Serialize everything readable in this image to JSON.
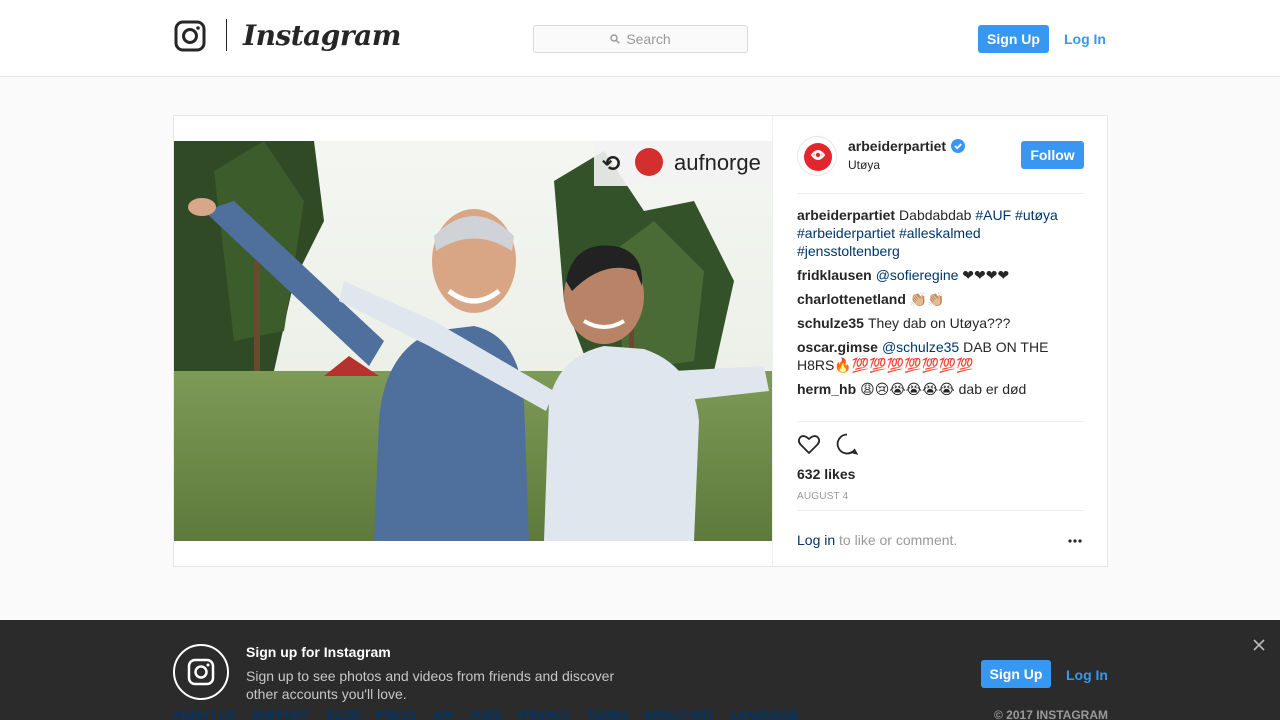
{
  "header": {
    "brand": "Instagram",
    "search_placeholder": "Search",
    "signup_label": "Sign Up",
    "login_label": "Log In"
  },
  "post": {
    "photo_overlay_text": "aufnorge",
    "username": "arbeiderpartiet",
    "location": "Utøya",
    "follow_label": "Follow",
    "caption": {
      "user": "arbeiderpartiet",
      "text": "Dabdabdab",
      "tags": [
        "#AUF",
        "#utøya",
        "#arbeiderpartiet",
        "#alleskalmed",
        "#jensstoltenberg"
      ]
    },
    "comments": [
      {
        "user": "fridklausen",
        "mention": "@sofieregine",
        "text": " ❤❤❤❤"
      },
      {
        "user": "charlottenetland",
        "mention": "",
        "text": "👏🏼👏🏼"
      },
      {
        "user": "schulze35",
        "mention": "",
        "text": "They dab on Utøya???"
      },
      {
        "user": "oscar.gimse",
        "mention": "@schulze35",
        "text": " DAB ON THE H8RS🔥💯💯💯💯💯💯💯"
      },
      {
        "user": "herm_hb",
        "mention": "",
        "text": "😩😢😭😭😭😭 dab er død"
      }
    ],
    "likes": "632 likes",
    "date": "AUGUST 4",
    "login_link": "Log in",
    "login_rest": " to like or comment."
  },
  "footer": {
    "title": "Sign up for Instagram",
    "description": "Sign up to see photos and videos from friends and discover other accounts you'll love.",
    "signup_label": "Sign Up",
    "login_label": "Log In",
    "links": [
      "ABOUT US",
      "SUPPORT",
      "BLOG",
      "PRESS",
      "API",
      "JOBS",
      "PRIVACY",
      "TERMS",
      "DIRECTORY",
      "LANGUAGE"
    ],
    "copyright": "© 2017 INSTAGRAM"
  },
  "colors": {
    "accent": "#3897f0",
    "link": "#003569",
    "text": "#262626",
    "muted": "#999999"
  }
}
